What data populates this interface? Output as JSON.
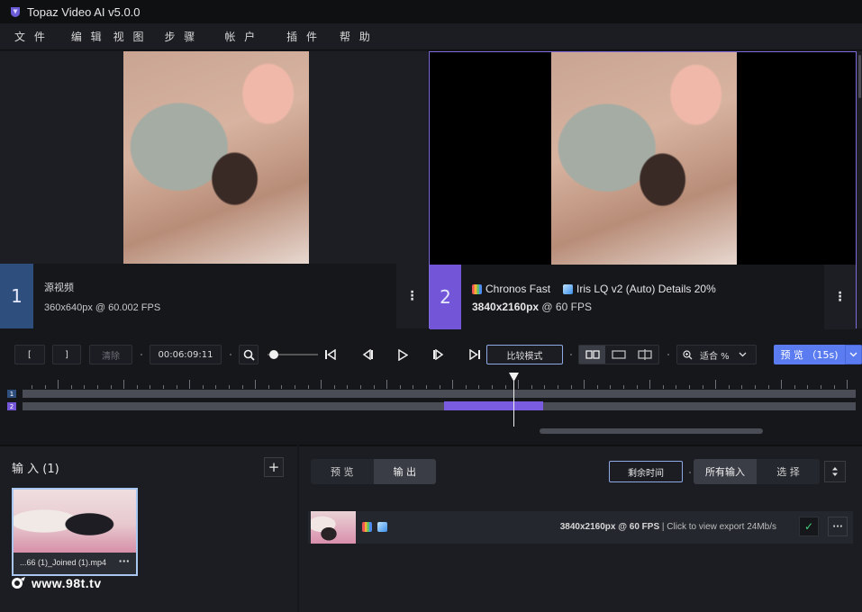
{
  "window": {
    "title": "Topaz Video AI  v5.0.0"
  },
  "menu": [
    "文 件",
    "编 辑",
    "视 图",
    "步 骤",
    "帐 户",
    "插 件",
    "帮 助"
  ],
  "source_pane": {
    "badge": "1",
    "label": "源视频",
    "spec": "360x640px @ 60.002 FPS",
    "more": "⋮"
  },
  "output_pane": {
    "badge": "2",
    "model_1": "Chronos Fast",
    "model_2": "Iris LQ v2 (Auto) Details 20%",
    "spec_bold": "3840x2160px",
    "spec_rest": " @ 60 FPS",
    "more": "⋮"
  },
  "controls": {
    "mark_in": "[",
    "mark_out": "]",
    "clear": "清除",
    "timecode": "00:06:09:11",
    "compare_mode": "比较模式",
    "zoom_fit": "适合 %",
    "preview_btn": "预 览 （15s)"
  },
  "timeline": {
    "track_1": "1",
    "track_2": "2"
  },
  "inputs": {
    "title": "输 入 (1)",
    "add": "+",
    "clip_name": "...66 (1)_Joined (1).mp4",
    "clip_more": "···",
    "watermark": "www.98t.tv"
  },
  "output": {
    "tabs": [
      "预 览",
      "输 出"
    ],
    "active_tab": "输 出",
    "remaining_time": "剩余时间",
    "filters": [
      "所有输入",
      "选 择"
    ],
    "job": {
      "spec_bold": "3840x2160px",
      "spec_rest": " @ 60 FPS",
      "status": "  |  Click to view export  24Mb/s",
      "check": "✓",
      "more": "···"
    }
  },
  "colors": {
    "accent": "#7356d8",
    "source_badge": "#2e4e7e",
    "primary_button": "#5b7bf0"
  },
  "icons": [
    "app-logo-icon",
    "search-icon",
    "skip-start-icon",
    "step-back-icon",
    "play-icon",
    "step-forward-icon",
    "skip-end-icon",
    "zoom-icon",
    "sort-icon"
  ]
}
